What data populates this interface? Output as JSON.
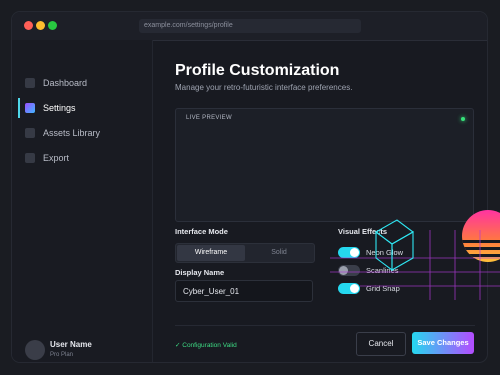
{
  "browser": {
    "url": "example.com/settings/profile"
  },
  "sidebar": {
    "items": [
      {
        "label": "Dashboard",
        "active": false
      },
      {
        "label": "Settings",
        "active": true
      },
      {
        "label": "Assets Library",
        "active": false
      },
      {
        "label": "Export",
        "active": false
      }
    ],
    "user": {
      "name": "User Name",
      "plan": "Pro Plan"
    }
  },
  "main": {
    "title": "Profile Customization",
    "subtitle": "Manage your retro-futuristic interface preferences.",
    "preview": {
      "label": "LIVE PREVIEW"
    },
    "interface_mode": {
      "label": "Interface Mode",
      "options": [
        "Wireframe",
        "Solid"
      ],
      "selected": "Wireframe"
    },
    "display_name": {
      "label": "Display Name",
      "value": "Cyber_User_01"
    },
    "visual_effects": {
      "label": "Visual Effects",
      "toggles": [
        {
          "label": "Neon Glow",
          "on": true
        },
        {
          "label": "Scanlines",
          "on": false
        },
        {
          "label": "Grid Snap",
          "on": true
        }
      ]
    },
    "status": "✓ Configuration Valid",
    "cancel_label": "Cancel",
    "save_label": "Save Changes"
  },
  "side_id": "1893513690",
  "colors": {
    "accent": "#25d8ef",
    "accent2": "#b44cff",
    "valid": "#3ddc84"
  }
}
